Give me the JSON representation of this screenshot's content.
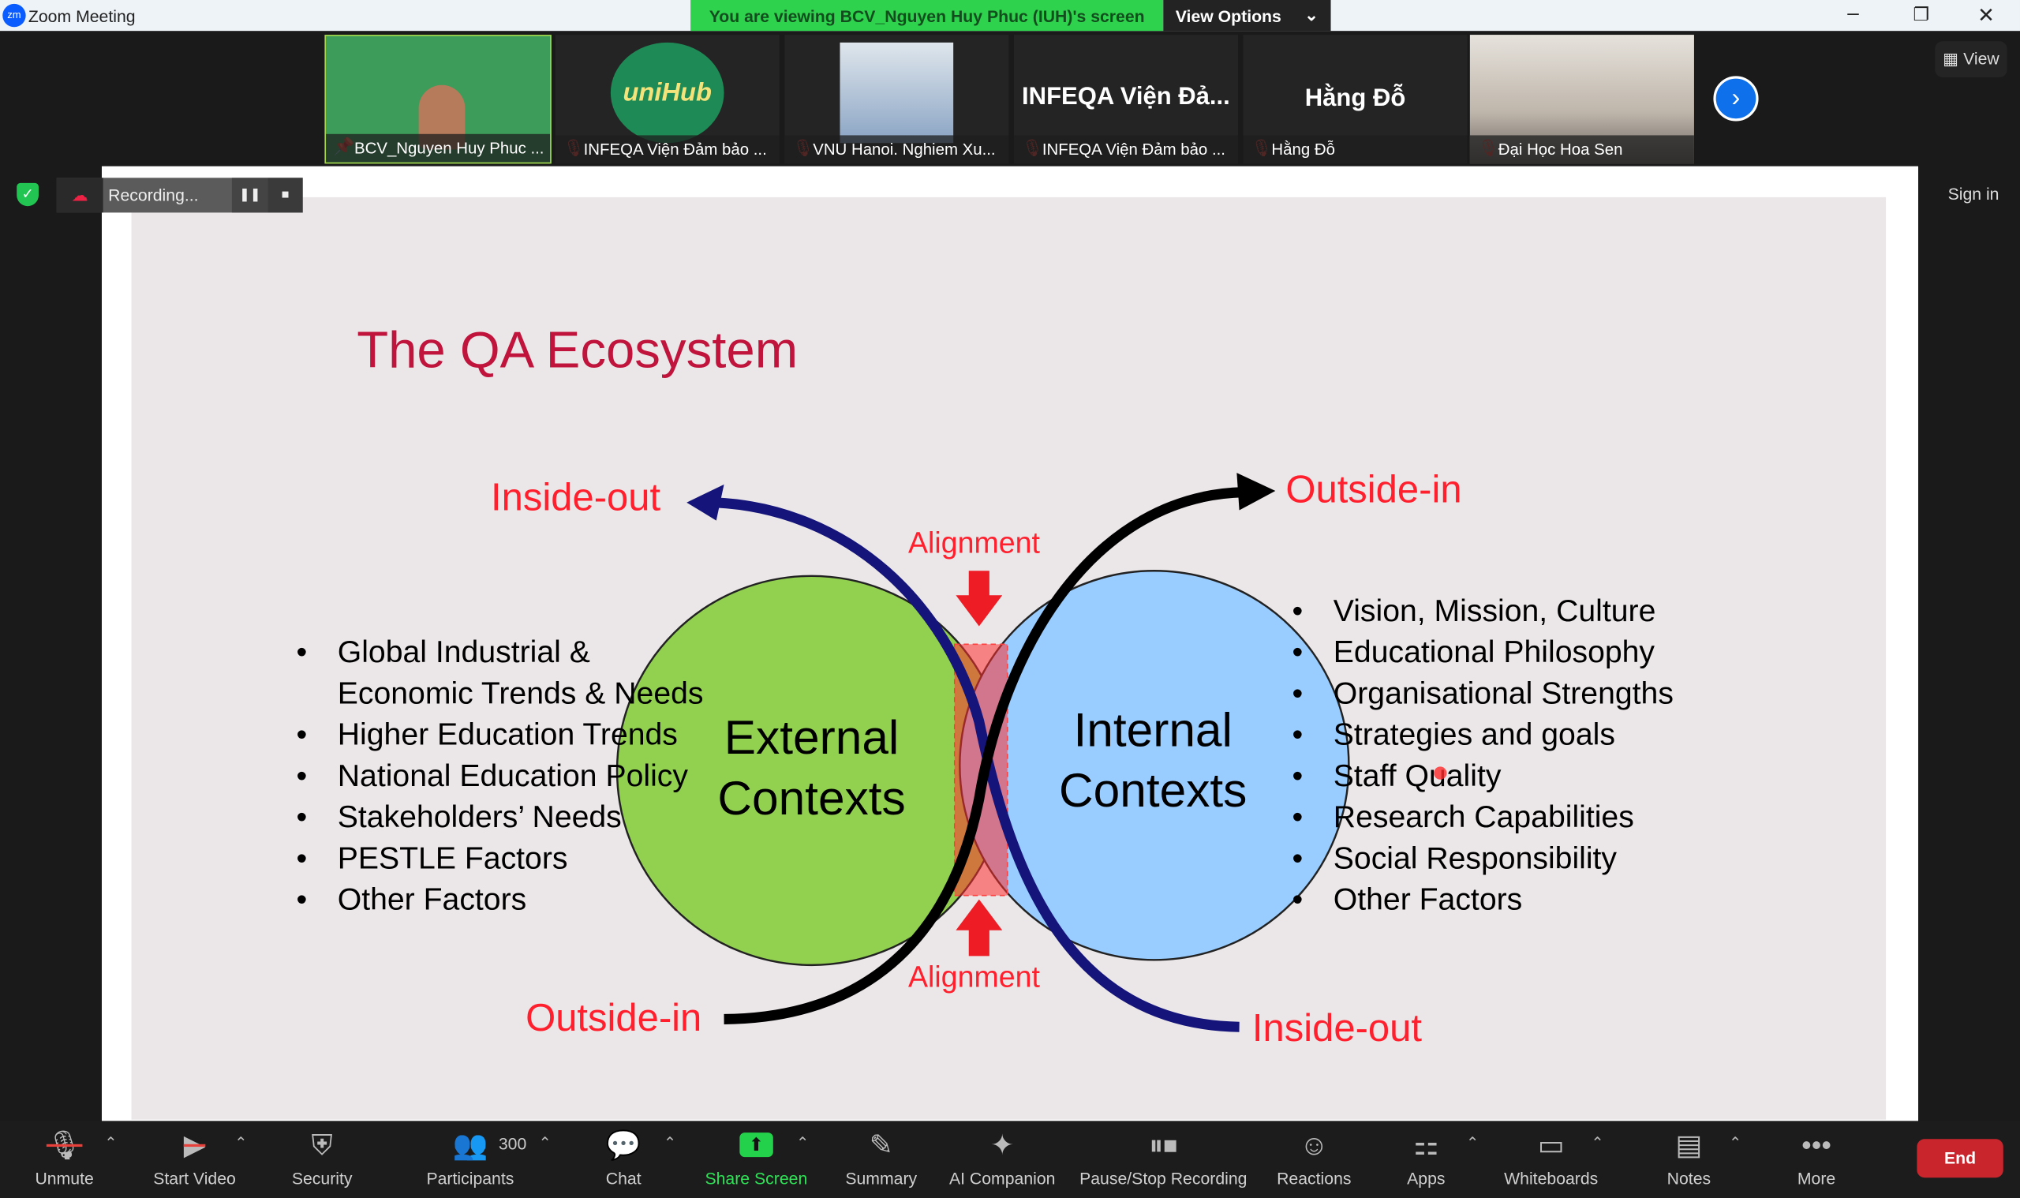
{
  "window": {
    "title": "Zoom Meeting",
    "app_icon": "zoom-logo"
  },
  "banner": {
    "text": "You are viewing BCV_Nguyen Huy Phuc (IUH)'s screen",
    "view_options": "View Options"
  },
  "thumbnails": [
    {
      "name": "BCV_Nguyen Huy Phuc ...",
      "muted": false,
      "pinned": true
    },
    {
      "name": "INFEQA Viện Đảm bảo ...",
      "muted": true,
      "logo_text": "uniHub"
    },
    {
      "name": "VNU Hanoi. Nghiem Xu...",
      "muted": true
    },
    {
      "name": "INFEQA Viện Đảm bảo ...",
      "muted": true,
      "big_text": "INFEQA Viện Đả..."
    },
    {
      "name": "Hằng Đỗ",
      "muted": true,
      "big_text": "Hằng Đỗ"
    },
    {
      "name": "Đại Học Hoa Sen",
      "muted": true
    }
  ],
  "view_button": "View",
  "sign_in": "Sign in",
  "recording": {
    "label": "Recording..."
  },
  "slide": {
    "title": "The QA Ecosystem",
    "labels": {
      "inside_out_top": "Inside-out",
      "outside_in_top": "Outside-in",
      "alignment_top": "Alignment",
      "alignment_bottom": "Alignment",
      "outside_in_bottom": "Outside-in",
      "inside_out_bottom": "Inside-out"
    },
    "external": [
      "External",
      "Contexts"
    ],
    "internal": [
      "Internal",
      "Contexts"
    ],
    "left_bullets": [
      "Global Industrial &",
      "Economic Trends & Needs",
      "Higher Education Trends",
      "National Education Policy",
      "Stakeholders’ Needs",
      "PESTLE Factors",
      "Other Factors"
    ],
    "right_bullets": [
      "Vision, Mission, Culture",
      "Educational Philosophy",
      "Organisational Strengths",
      "Strategies and goals",
      "Staff Quality",
      "Research Capabilities",
      "Social Responsibility",
      "Other Factors"
    ],
    "colors": {
      "title": "#c0143c",
      "label": "#ff1f2d",
      "green": "#92d050",
      "blue": "#99ccff",
      "navy": "#14147a"
    }
  },
  "toolbar": {
    "items": [
      {
        "label": "Unmute",
        "icon": "mic-muted-icon"
      },
      {
        "label": "Start Video",
        "icon": "video-off-icon"
      },
      {
        "label": "Security",
        "icon": "shield-icon"
      },
      {
        "label": "Participants",
        "icon": "participants-icon",
        "count": "300"
      },
      {
        "label": "Chat",
        "icon": "chat-icon"
      },
      {
        "label": "Share Screen",
        "icon": "share-screen-icon"
      },
      {
        "label": "Summary",
        "icon": "summary-icon"
      },
      {
        "label": "AI Companion",
        "icon": "sparkle-icon"
      },
      {
        "label": "Pause/Stop Recording",
        "icon": "pause-stop-icon"
      },
      {
        "label": "Reactions",
        "icon": "reactions-icon"
      },
      {
        "label": "Apps",
        "icon": "apps-icon"
      },
      {
        "label": "Whiteboards",
        "icon": "whiteboard-icon"
      },
      {
        "label": "Notes",
        "icon": "notes-icon"
      },
      {
        "label": "More",
        "icon": "more-icon"
      }
    ],
    "end": "End"
  }
}
